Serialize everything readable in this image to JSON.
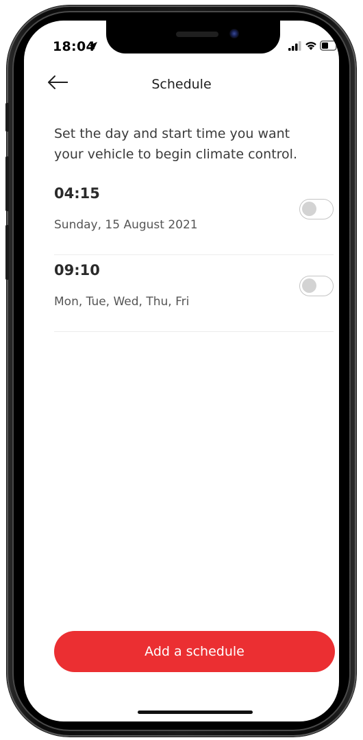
{
  "status_bar": {
    "time": "18:04",
    "location_icon": "location-arrow-icon",
    "signal_icon": "cellular-signal-icon",
    "wifi_icon": "wifi-icon",
    "battery_icon": "battery-icon"
  },
  "header": {
    "back_icon": "arrow-left-icon",
    "title": "Schedule"
  },
  "intro": "Set the day and start time you want your vehicle to begin climate control.",
  "schedules": [
    {
      "time": "04:15",
      "days": "Sunday, 15 August 2021",
      "enabled": false
    },
    {
      "time": "09:10",
      "days": "Mon, Tue, Wed, Thu, Fri",
      "enabled": false
    }
  ],
  "add_button_label": "Add a schedule",
  "colors": {
    "accent": "#eb2f32",
    "toggle_off": "#d3d3d3"
  }
}
